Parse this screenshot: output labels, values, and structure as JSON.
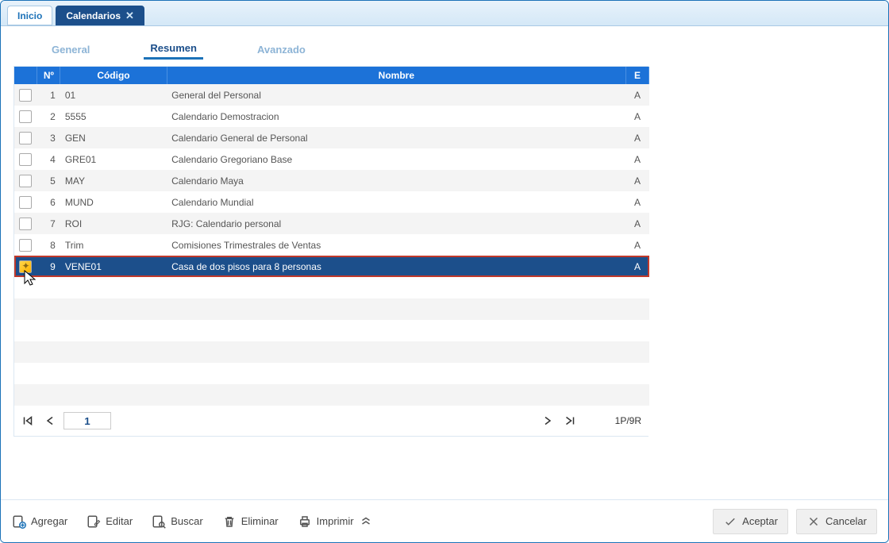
{
  "tabs": {
    "home": "Inicio",
    "active": "Calendarios"
  },
  "subtabs": {
    "general": "General",
    "resumen": "Resumen",
    "avanzado": "Avanzado"
  },
  "grid": {
    "headers": {
      "num": "Nº",
      "codigo": "Código",
      "nombre": "Nombre",
      "e": "E"
    },
    "rows": [
      {
        "n": "1",
        "codigo": "01",
        "nombre": "General del Personal",
        "e": "A",
        "selected": false
      },
      {
        "n": "2",
        "codigo": "5555",
        "nombre": "Calendario Demostracion",
        "e": "A",
        "selected": false
      },
      {
        "n": "3",
        "codigo": "GEN",
        "nombre": "Calendario General de Personal",
        "e": "A",
        "selected": false
      },
      {
        "n": "4",
        "codigo": "GRE01",
        "nombre": "Calendario Gregoriano Base",
        "e": "A",
        "selected": false
      },
      {
        "n": "5",
        "codigo": "MAY",
        "nombre": "Calendario Maya",
        "e": "A",
        "selected": false
      },
      {
        "n": "6",
        "codigo": "MUND",
        "nombre": "Calendario Mundial",
        "e": "A",
        "selected": false
      },
      {
        "n": "7",
        "codigo": "ROI",
        "nombre": "RJG: Calendario personal",
        "e": "A",
        "selected": false
      },
      {
        "n": "8",
        "codigo": "Trim",
        "nombre": "Comisiones Trimestrales de Ventas",
        "e": "A",
        "selected": false
      },
      {
        "n": "9",
        "codigo": "VENE01",
        "nombre": "Casa de dos pisos para 8 personas",
        "e": "A",
        "selected": true
      }
    ],
    "emptyRows": 6
  },
  "pager": {
    "page": "1",
    "info": "1P/9R"
  },
  "toolbar": {
    "agregar": "Agregar",
    "editar": "Editar",
    "buscar": "Buscar",
    "eliminar": "Eliminar",
    "imprimir": "Imprimir",
    "aceptar": "Aceptar",
    "cancelar": "Cancelar"
  }
}
